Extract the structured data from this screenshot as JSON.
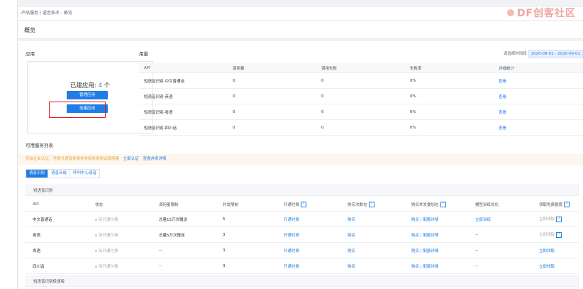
{
  "breadcrumb": "产品服务 / 语音技术 - 概览",
  "watermark": "DF创客社区",
  "page_title": "概览",
  "apps": {
    "section_label": "应用",
    "count_text": "已建应用:",
    "count": "4",
    "unit": "个",
    "manage_label": "管理应用",
    "create_label": "创建应用"
  },
  "usage": {
    "section_label": "用量",
    "date_label": "请选择时间段",
    "date_value": "2020-09-01 - 2020-09-01",
    "columns": [
      "API",
      "调用量",
      "调用失败",
      "失败率",
      "详细统计"
    ],
    "rows": [
      {
        "api": "短语音识别-中文普通话",
        "calls": "0",
        "fails": "0",
        "rate": "0%",
        "detail": "查看"
      },
      {
        "api": "短语音识别-英语",
        "calls": "0",
        "fails": "0",
        "rate": "0%",
        "detail": "查看"
      },
      {
        "api": "短语音识别-粤语",
        "calls": "0",
        "fails": "0",
        "rate": "0%",
        "detail": "查看"
      },
      {
        "api": "短语音识别-四川话",
        "calls": "0",
        "fails": "0",
        "rate": "0%",
        "detail": "查看"
      }
    ]
  },
  "services": {
    "section_label": "可用服务列表",
    "notice": "完成企业认证，可提升语音免费并发和免费测试调用量",
    "notice_link1": "立即认证",
    "notice_link2": "查看并发详情",
    "tabs": [
      "语音识别",
      "语音合成",
      "呼叫中心语音"
    ],
    "group1": "短语音识别",
    "group2": "短语音识别极速版",
    "columns": [
      "API",
      "状态",
      "调用量限制",
      "并发限制",
      "开通付费",
      "购买次数包",
      "购买并发叠加包",
      "模型训练优化",
      "领取免费额度"
    ],
    "q": "?",
    "rows": [
      {
        "api": "中文普通话",
        "status": "待开通付费",
        "limit": "总量15万次赠送",
        "concurrency": "5",
        "pay": "开通付费",
        "buy": "购买",
        "buy_conc": "购买 | 配额详情",
        "train": "立即训练",
        "free": "立即领取"
      },
      {
        "api": "英语",
        "status": "待开通付费",
        "limit": "总量5万次赠送",
        "concurrency": "3",
        "pay": "开通付费",
        "buy": "购买",
        "buy_conc": "购买 | 配额详情",
        "train": "--",
        "free": "立即领取"
      },
      {
        "api": "粤语",
        "status": "待开通付费",
        "limit": "--",
        "concurrency": "3",
        "pay": "开通付费",
        "buy": "购买",
        "buy_conc": "购买 | 配额详情",
        "train": "--",
        "free": "立即领取"
      },
      {
        "api": "四川话",
        "status": "待开通付费",
        "limit": "--",
        "concurrency": "3",
        "pay": "开通付费",
        "buy": "购买",
        "buy_conc": "购买 | 配额详情",
        "train": "--",
        "free": "立即领取"
      }
    ]
  },
  "colors": {
    "accent": "#1e7ee6",
    "highlight": "#e02020",
    "notice": "#e6a23c"
  }
}
